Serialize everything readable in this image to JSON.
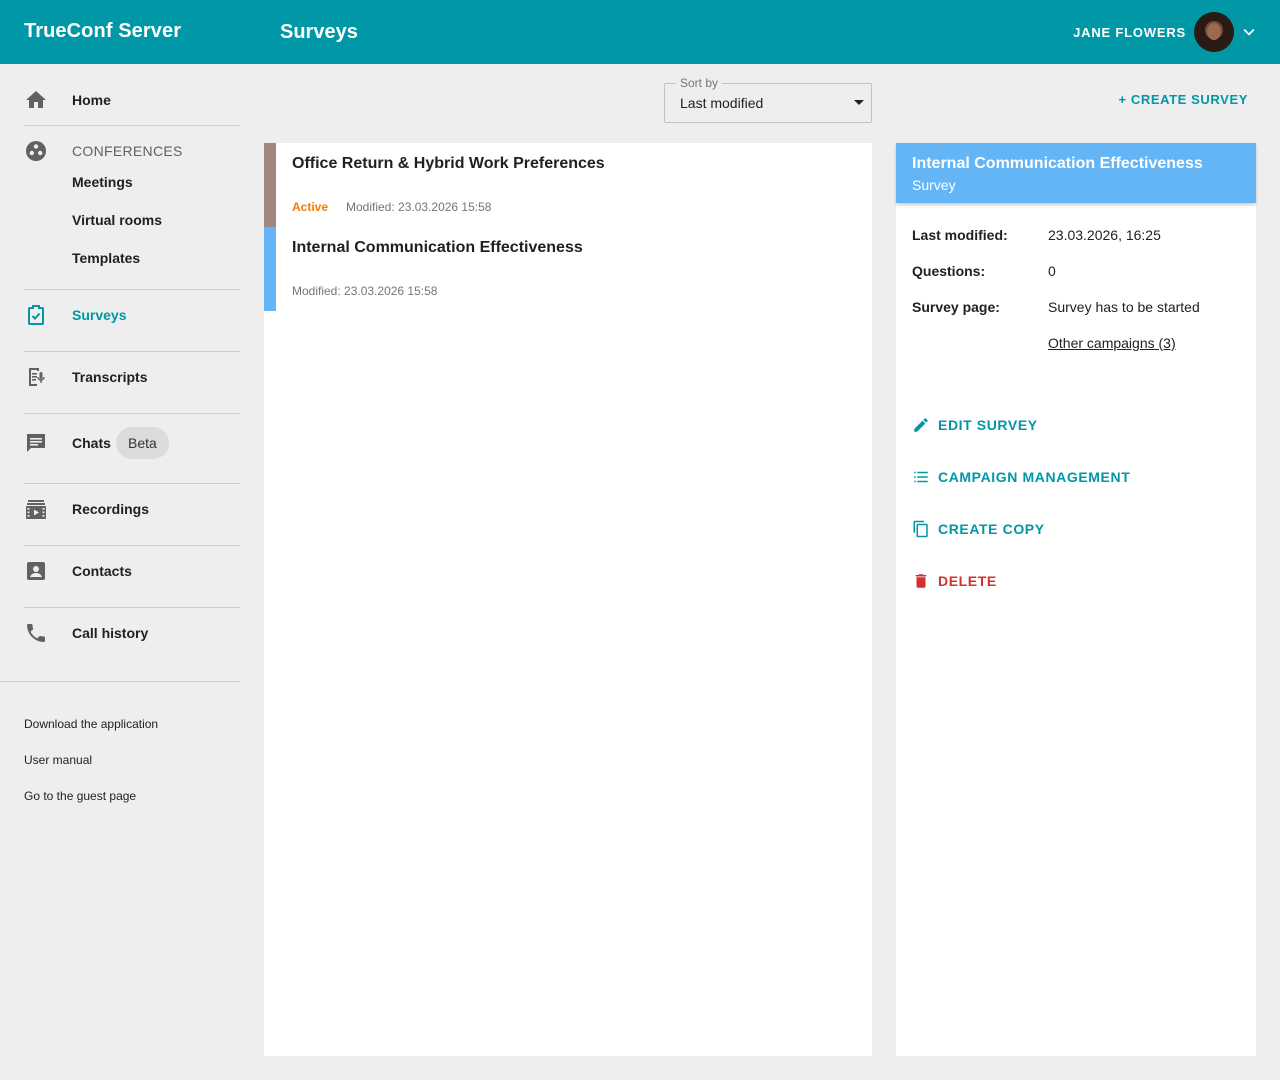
{
  "header": {
    "brand": "TrueConf Server",
    "page_title": "Surveys",
    "user_name": "JANE FLOWERS"
  },
  "sidebar": {
    "home": "Home",
    "conferences_label": "CONFERENCES",
    "meetings": "Meetings",
    "virtual_rooms": "Virtual rooms",
    "templates": "Templates",
    "surveys": "Surveys",
    "transcripts": "Transcripts",
    "chats": "Chats",
    "chats_badge": "Beta",
    "recordings": "Recordings",
    "contacts": "Contacts",
    "call_history": "Call history",
    "footer_links": [
      "Download the application",
      "User manual",
      "Go to the guest page"
    ]
  },
  "toolbar": {
    "sort_label": "Sort by",
    "sort_value": "Last modified",
    "create_label": "+ CREATE SURVEY"
  },
  "surveys": [
    {
      "title": "Office Return & Hybrid Work Preferences",
      "status": "Active",
      "modified": "Modified: 23.03.2026 15:58",
      "color": "#a1887f"
    },
    {
      "title": "Internal Communication Effectiveness",
      "status": "",
      "modified": "Modified: 23.03.2026 15:58",
      "color": "#64b5f6"
    }
  ],
  "detail": {
    "title": "Internal Communication Effectiveness",
    "subtitle": "Survey",
    "last_modified_label": "Last modified:",
    "last_modified_value": "23.03.2026, 16:25",
    "questions_label": "Questions:",
    "questions_value": "0",
    "survey_page_label": "Survey page:",
    "survey_page_value": "Survey has to be started",
    "other_campaigns": "Other campaigns (3)",
    "actions": {
      "edit": "EDIT SURVEY",
      "campaigns": "CAMPAIGN MANAGEMENT",
      "copy": "CREATE COPY",
      "delete": "DELETE"
    }
  },
  "colors": {
    "accent": "#0097a7",
    "header_bg": "#0097a7",
    "detail_head": "#64b5f6",
    "status_active": "#f57c00",
    "danger": "#d32f2f"
  }
}
